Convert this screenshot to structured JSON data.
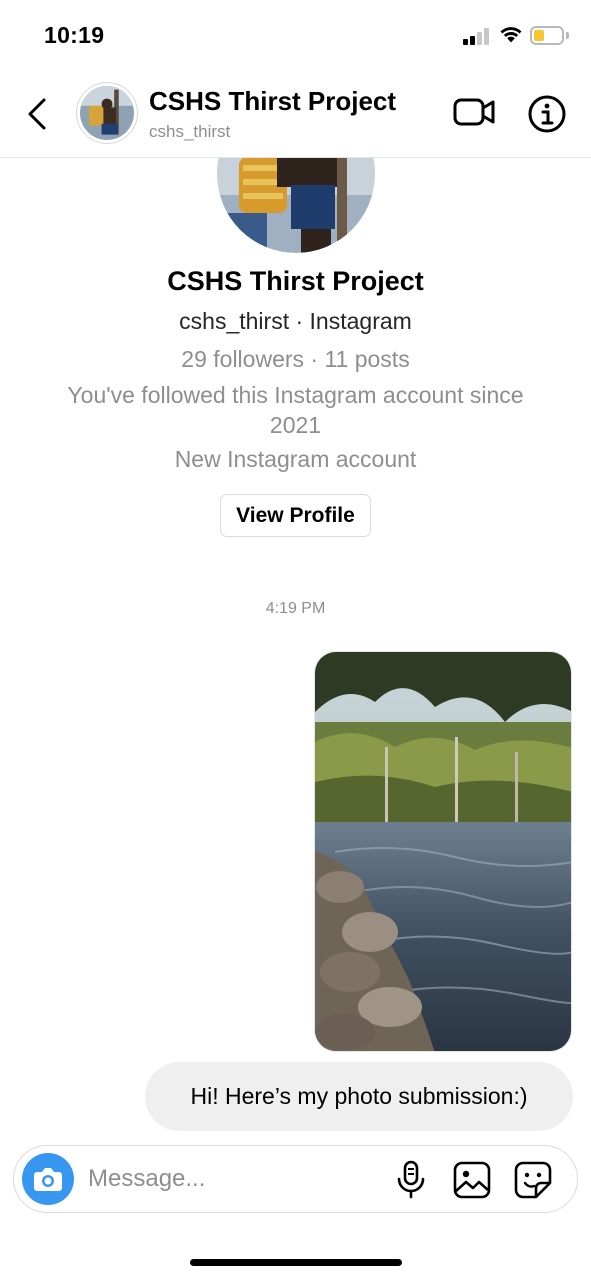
{
  "status_bar": {
    "time": "10:19",
    "icons": [
      "cellular-signal-icon",
      "wifi-icon",
      "battery-icon"
    ],
    "battery_color": "#f7c831"
  },
  "header": {
    "back_icon": "chevron-left-icon",
    "title": "CSHS Thirst Project",
    "subtitle": "cshs_thirst",
    "actions": [
      "video-call-icon",
      "info-icon"
    ]
  },
  "profile": {
    "name": "CSHS Thirst Project",
    "handle_line": "cshs_thirst · Instagram",
    "stats": "29 followers · 11 posts",
    "since": "You've followed this Instagram account since 2021",
    "new_account": "New Instagram account",
    "view_profile_label": "View Profile"
  },
  "thread": {
    "timestamp": "4:19 PM",
    "messages": [
      {
        "type": "photo",
        "from": "me",
        "depicts": "river-with-rocks-and-trees"
      },
      {
        "type": "text",
        "from": "me",
        "text": "Hi! Here’s my photo submission:)"
      }
    ]
  },
  "composer": {
    "placeholder": "Message...",
    "icons": [
      "camera-icon",
      "microphone-icon",
      "gallery-icon",
      "sticker-icon"
    ],
    "accent_color": "#3797f0"
  }
}
